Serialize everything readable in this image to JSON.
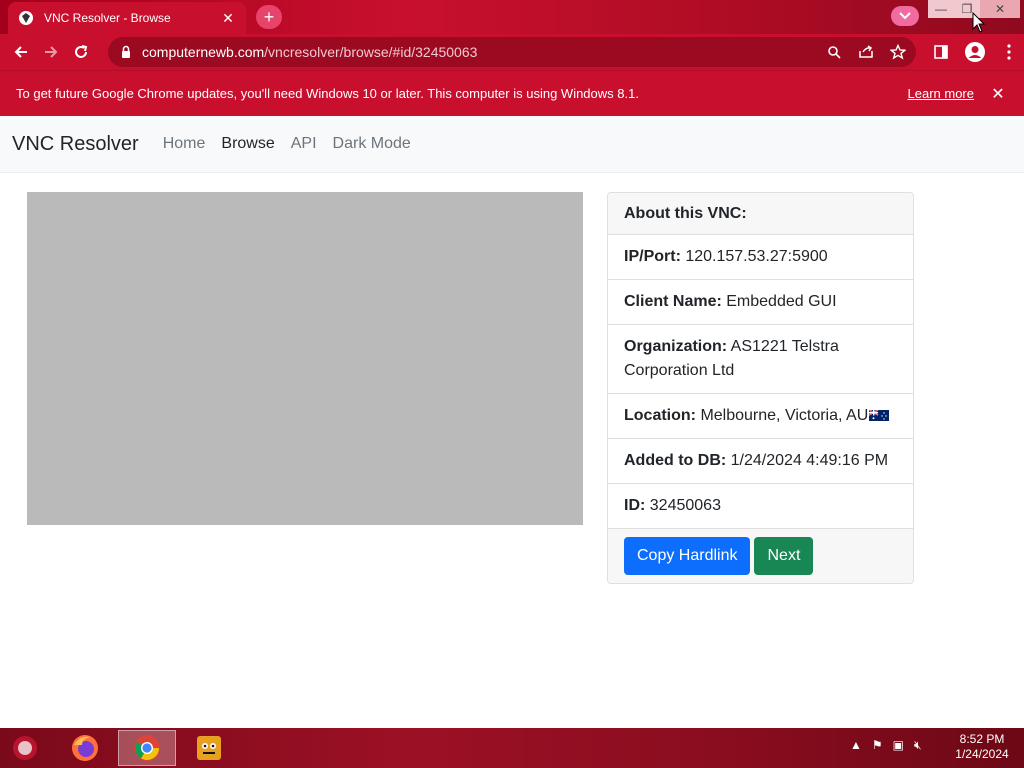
{
  "browser": {
    "tab_title": "VNC Resolver - Browse",
    "url_host": "computernewb.com",
    "url_path": "/vncresolver/browse/#id/32450063",
    "accent": "#c8102e"
  },
  "infobar": {
    "message": "To get future Google Chrome updates, you'll need Windows 10 or later. This computer is using Windows 8.1.",
    "learn_more": "Learn more"
  },
  "navbar": {
    "brand": "VNC Resolver",
    "links": [
      "Home",
      "Browse",
      "API",
      "Dark Mode"
    ]
  },
  "card": {
    "header": "About this VNC:",
    "rows": [
      {
        "label": "IP/Port:",
        "value": "120.157.53.27:5900"
      },
      {
        "label": "Client Name:",
        "value": "Embedded GUI"
      },
      {
        "label": "Organization:",
        "value": "AS1221 Telstra Corporation Ltd"
      },
      {
        "label": "Location:",
        "value": "Melbourne, Victoria, AU"
      },
      {
        "label": "Added to DB:",
        "value": "1/24/2024 4:49:16 PM"
      },
      {
        "label": "ID:",
        "value": "32450063"
      }
    ],
    "buttons": {
      "copy": "Copy Hardlink",
      "next": "Next"
    }
  },
  "taskbar": {
    "time": "8:52 PM",
    "date": "1/24/2024"
  }
}
